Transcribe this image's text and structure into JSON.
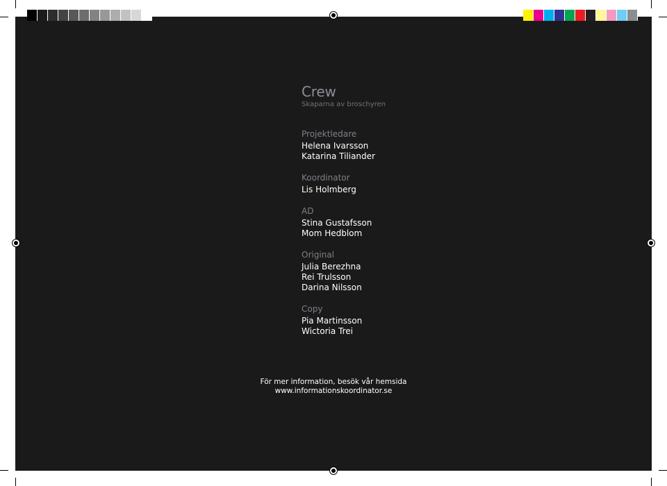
{
  "color_bars": {
    "gray_swatches": [
      "#000000",
      "#1c1c1c",
      "#2e2e2e",
      "#434343",
      "#585858",
      "#6d6d6d",
      "#838383",
      "#989898",
      "#adadad",
      "#c2c2c2",
      "#d7d7d7",
      "#ffffff"
    ],
    "cmyk_swatches": [
      "#fff200",
      "#ec008c",
      "#00aeef",
      "#2e3192",
      "#00a651",
      "#ed1c24",
      "#231f20",
      "#fff799",
      "#f49ac1",
      "#6dcff6",
      "#8a8c8e"
    ]
  },
  "crew": {
    "title": "Crew",
    "subtitle": "Skaparna av broschyren",
    "roles": [
      {
        "label": "Projektledare",
        "names": [
          "Helena Ivarsson",
          "Katarina Tiliander"
        ]
      },
      {
        "label": "Koordinator",
        "names": [
          "Lis Holmberg"
        ]
      },
      {
        "label": "AD",
        "names": [
          "Stina Gustafsson",
          "Mom Hedblom"
        ]
      },
      {
        "label": "Original",
        "names": [
          "Julia Berezhna",
          "Rei Trulsson",
          "Darina Nilsson"
        ]
      },
      {
        "label": "Copy",
        "names": [
          "Pia Martinsson",
          "Wictoria Trei"
        ]
      }
    ]
  },
  "info": {
    "line1": "För mer information, besök vår hemsida",
    "line2": "www.informationskoordinator.se"
  }
}
